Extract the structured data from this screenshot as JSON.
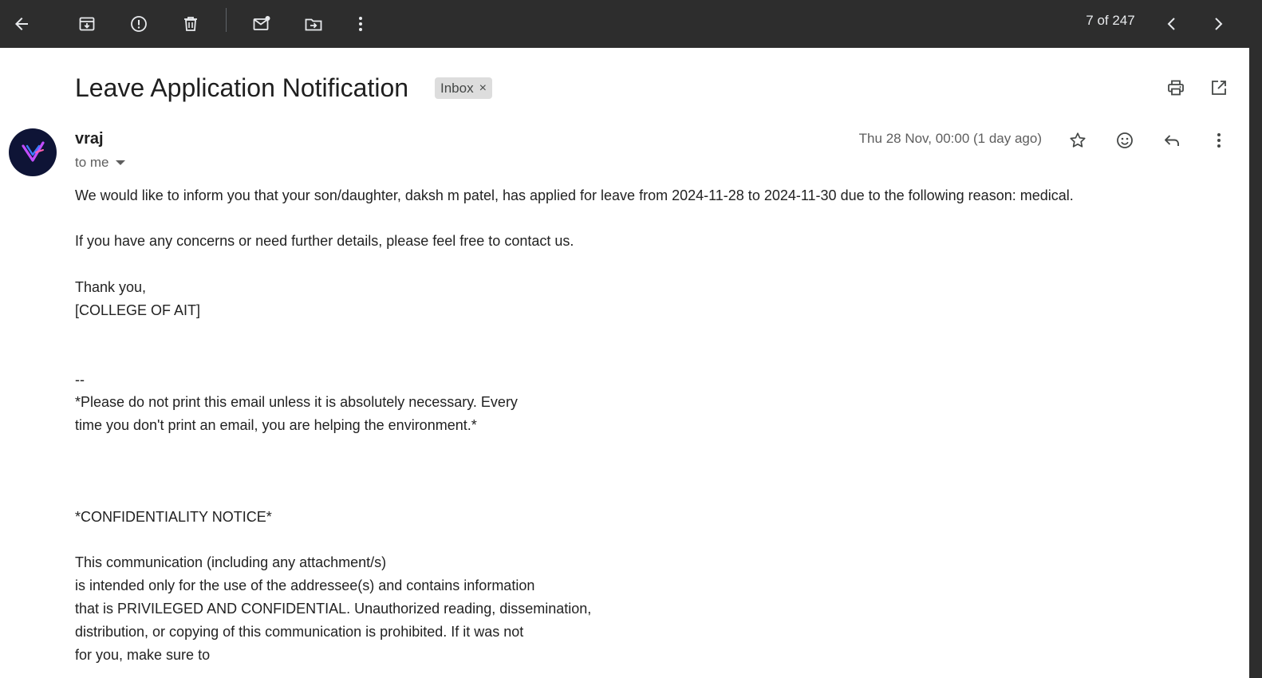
{
  "toolbar": {
    "back_icon": "arrow-back-icon",
    "archive_icon": "archive-icon",
    "spam_icon": "report-spam-icon",
    "delete_icon": "trash-icon",
    "mark_unread_icon": "mark-unread-icon",
    "move_icon": "move-to-folder-icon",
    "more_icon": "more-vert-icon",
    "pager_text": "7 of 247",
    "prev_icon": "chevron-left-icon",
    "next_icon": "chevron-right-icon",
    "background_color": "#2d2d2d"
  },
  "email": {
    "subject": "Leave Application Notification",
    "label": "Inbox",
    "label_remove": "×",
    "sender_name": "vraj",
    "recipient": "to me",
    "date": "Thu 28 Nov, 00:00 (1 day ago)",
    "body": {
      "line1": "We would like to inform you that your son/daughter, daksh m patel, has applied for leave from 2024-11-28 to 2024-11-30 due to the following reason: medical.",
      "line2": "If you have any concerns or need further details, please feel free to contact us.",
      "closing": "Thank you,",
      "org": "[COLLEGE OF AIT]",
      "sig_dash": "--",
      "env_line1": "*Please do not print this email unless it is absolutely necessary. Every",
      "env_line2": "time you don't print an email, you are helping the environment.*",
      "conf_title": "*CONFIDENTIALITY NOTICE*",
      "conf_line1": "This communication (including any attachment/s)",
      "conf_line2": "is intended only for the use of the addressee(s) and contains information",
      "conf_line3": "that is PRIVILEGED AND CONFIDENTIAL. Unauthorized reading, dissemination,",
      "conf_line4": "distribution, or copying of this communication is prohibited. If it was not",
      "conf_line5": "for you, make sure to"
    }
  },
  "header_icons": {
    "print": "print-icon",
    "open_new_window": "open-in-new-icon",
    "star": "star-icon",
    "emoji": "emoji-reaction-icon",
    "reply": "reply-icon",
    "more": "more-vert-icon"
  },
  "colors": {
    "toolbar_icon": "#e8eaed",
    "text_primary": "#1f1f1f",
    "text_secondary": "#5e5e5e",
    "label_bg": "#dddddd",
    "avatar_bg": "#0e1436"
  }
}
